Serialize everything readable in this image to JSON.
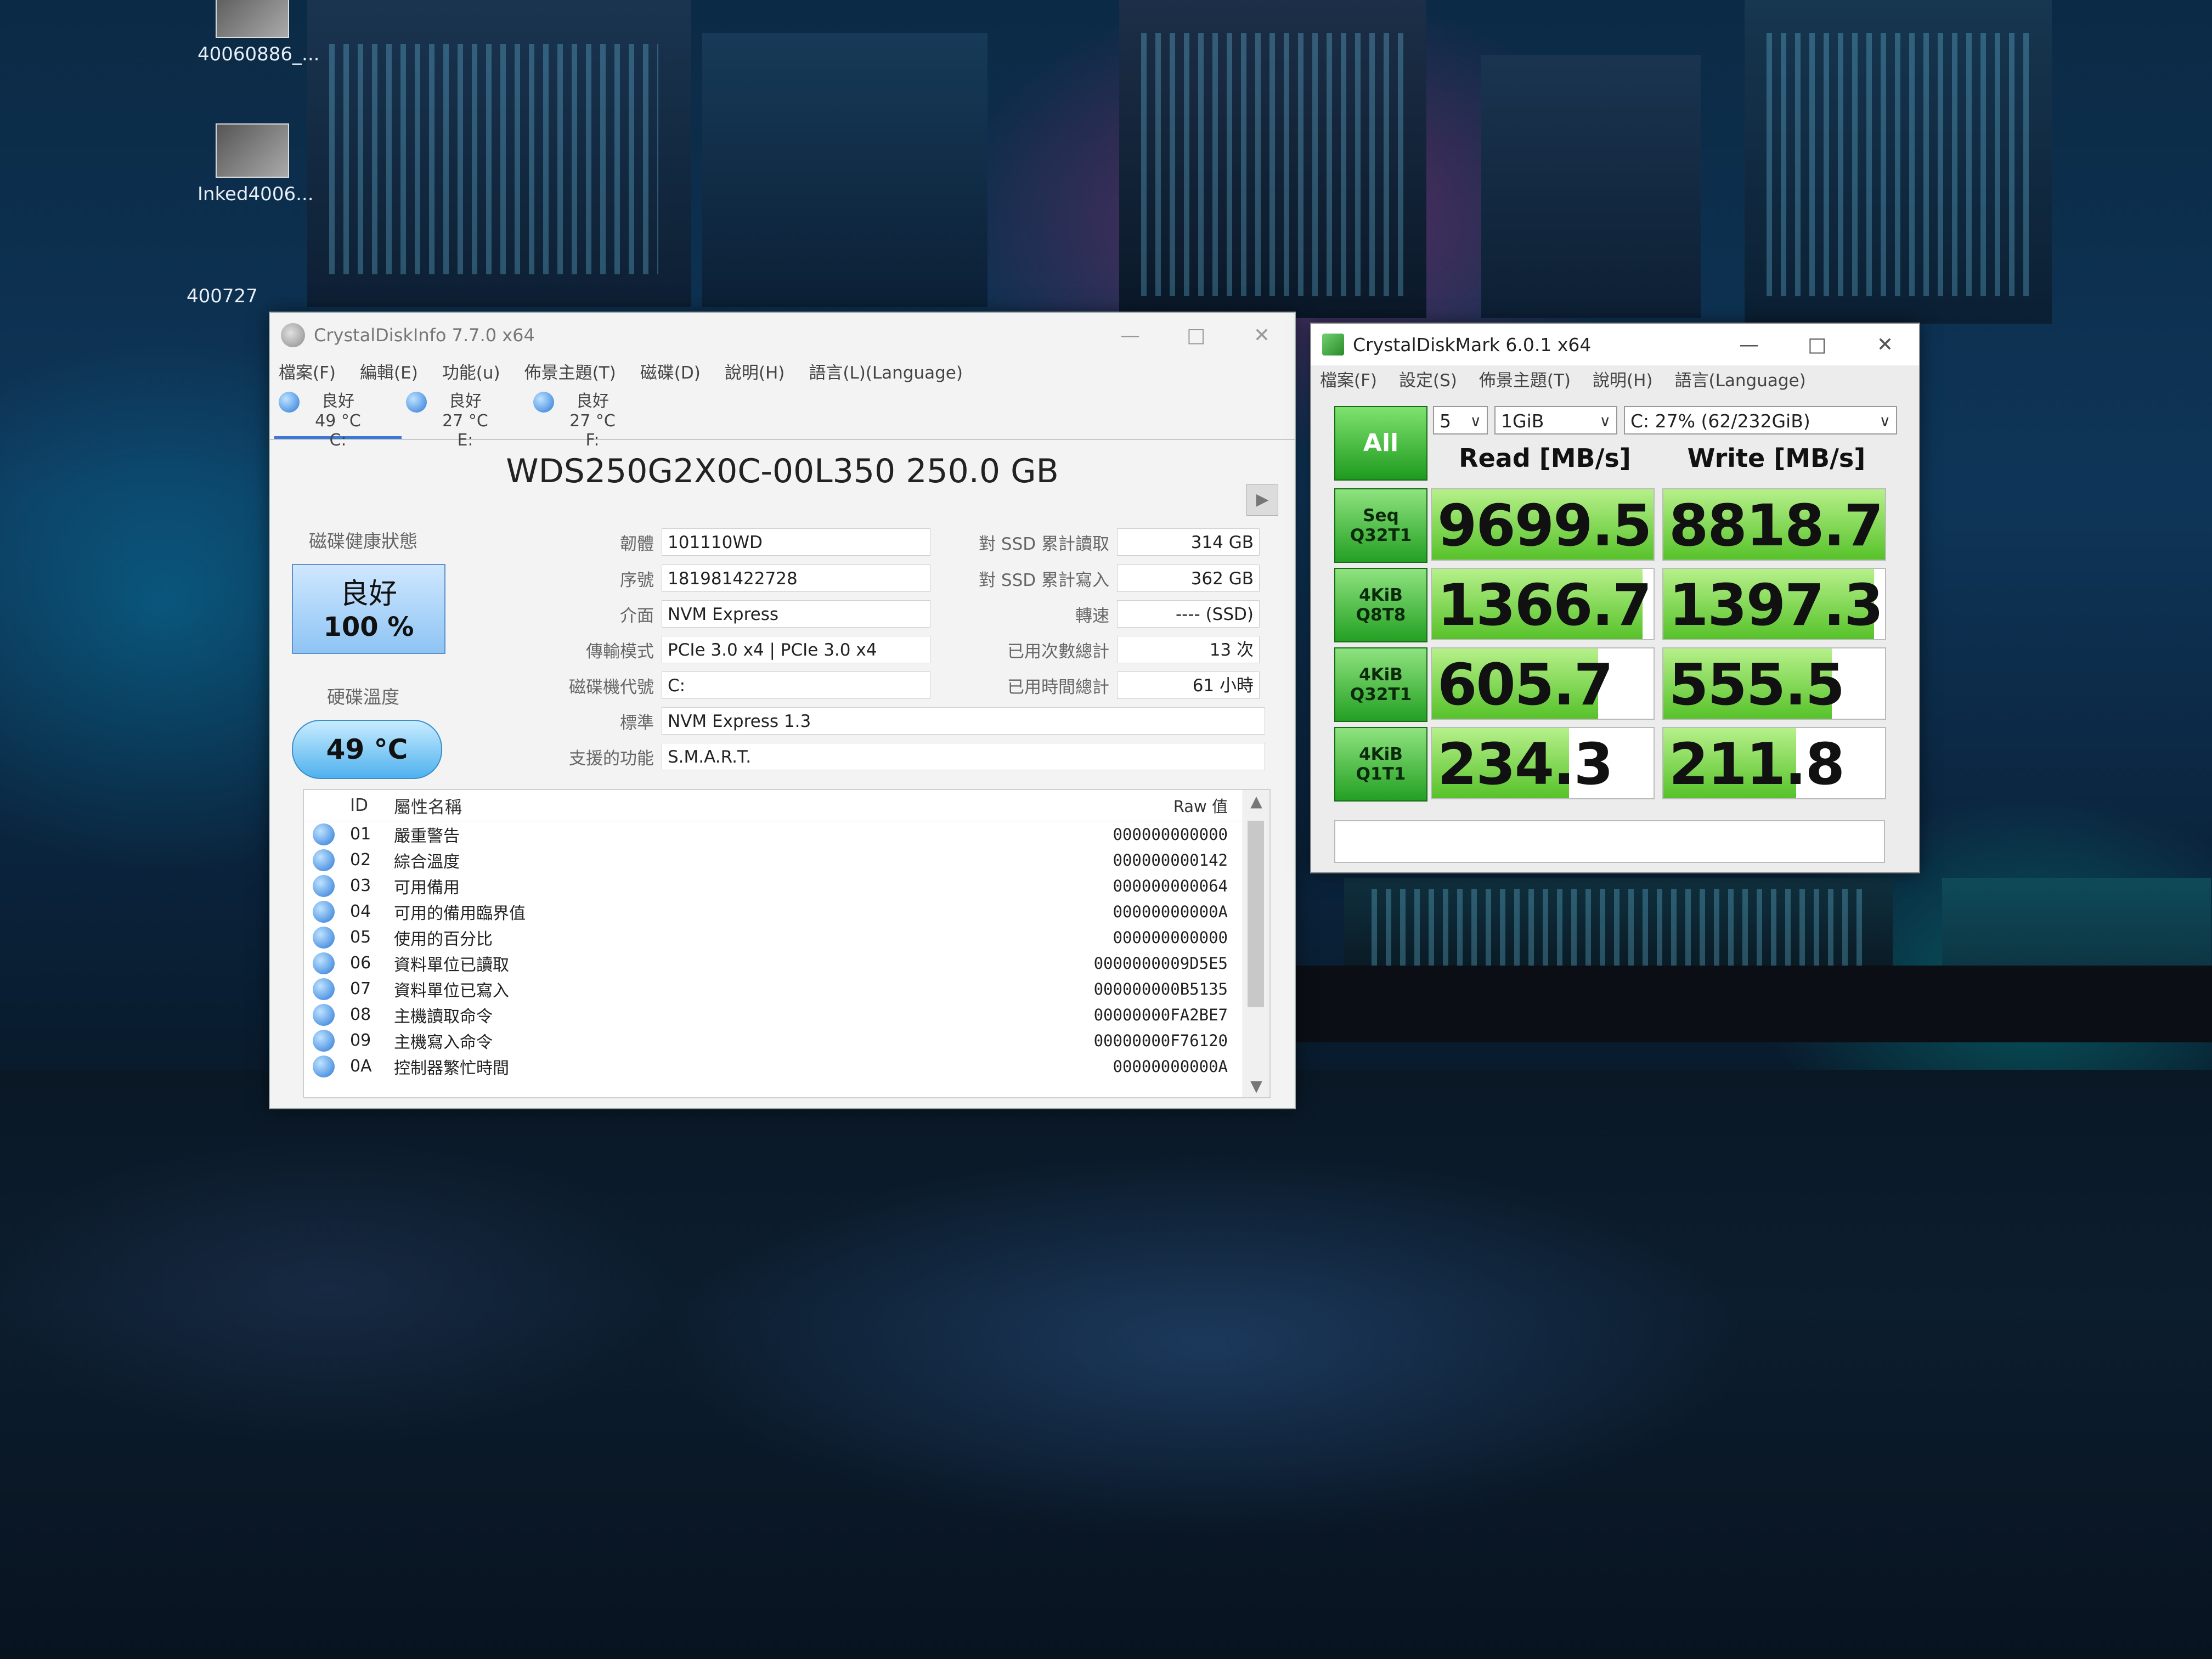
{
  "desktop": {
    "icons": [
      {
        "label": "40060886_..."
      },
      {
        "label": "Inked4006..."
      },
      {
        "label": "400727"
      }
    ]
  },
  "cdi": {
    "title": "CrystalDiskInfo 7.7.0 x64",
    "menu": [
      "檔案(F)",
      "編輯(E)",
      "功能(u)",
      "佈景主題(T)",
      "磁碟(D)",
      "說明(H)",
      "語言(L)(Language)"
    ],
    "disks": [
      {
        "status": "良好",
        "temp": "49 °C",
        "letter": "C:"
      },
      {
        "status": "良好",
        "temp": "27 °C",
        "letter": "E:"
      },
      {
        "status": "良好",
        "temp": "27 °C",
        "letter": "F:"
      }
    ],
    "model": "WDS250G2X0C-00L350 250.0 GB",
    "health_label": "磁碟健康狀態",
    "health_status": "良好",
    "health_percent": "100 %",
    "temp_label": "硬碟溫度",
    "temp_value": "49 °C",
    "fields": {
      "firmware_label": "韌體",
      "firmware": "101110WD",
      "serial_label": "序號",
      "serial": "181981422728",
      "interface_label": "介面",
      "interface": "NVM Express",
      "transfer_label": "傳輸模式",
      "transfer": "PCIe 3.0 x4 | PCIe 3.0 x4",
      "drive_letter_label": "磁碟機代號",
      "drive_letter": "C:",
      "standard_label": "標準",
      "standard": "NVM Express 1.3",
      "features_label": "支援的功能",
      "features": "S.M.A.R.T.",
      "host_reads_label": "對 SSD 累計讀取",
      "host_reads": "314 GB",
      "host_writes_label": "對 SSD 累計寫入",
      "host_writes": "362 GB",
      "rotation_label": "轉速",
      "rotation": "---- (SSD)",
      "power_count_label": "已用次數總計",
      "power_count": "13 次",
      "power_hours_label": "已用時間總計",
      "power_hours": "61 小時"
    },
    "table": {
      "col_id": "ID",
      "col_name": "屬性名稱",
      "col_raw": "Raw 值",
      "rows": [
        {
          "id": "01",
          "name": "嚴重警告",
          "raw": "000000000000"
        },
        {
          "id": "02",
          "name": "綜合溫度",
          "raw": "000000000142"
        },
        {
          "id": "03",
          "name": "可用備用",
          "raw": "000000000064"
        },
        {
          "id": "04",
          "name": "可用的備用臨界值",
          "raw": "00000000000A"
        },
        {
          "id": "05",
          "name": "使用的百分比",
          "raw": "000000000000"
        },
        {
          "id": "06",
          "name": "資料單位已讀取",
          "raw": "0000000009D5E5"
        },
        {
          "id": "07",
          "name": "資料單位已寫入",
          "raw": "000000000B5135"
        },
        {
          "id": "08",
          "name": "主機讀取命令",
          "raw": "00000000FA2BE7"
        },
        {
          "id": "09",
          "name": "主機寫入命令",
          "raw": "00000000F76120"
        },
        {
          "id": "0A",
          "name": "控制器繁忙時間",
          "raw": "00000000000A"
        }
      ]
    }
  },
  "cdm": {
    "title": "CrystalDiskMark 6.0.1 x64",
    "menu": [
      "檔案(F)",
      "設定(S)",
      "佈景主題(T)",
      "說明(H)",
      "語言(Language)"
    ],
    "all_label": "All",
    "count": "5",
    "size": "1GiB",
    "drive": "C: 27% (62/232GiB)",
    "read_header": "Read [MB/s]",
    "write_header": "Write [MB/s]",
    "rows": [
      {
        "label1": "Seq",
        "label2": "Q32T1",
        "read": "9699.5",
        "write": "8818.7",
        "read_fill": 1.0,
        "write_fill": 1.0
      },
      {
        "label1": "4KiB",
        "label2": "Q8T8",
        "read": "1366.7",
        "write": "1397.3",
        "read_fill": 0.95,
        "write_fill": 0.95
      },
      {
        "label1": "4KiB",
        "label2": "Q32T1",
        "read": "605.7",
        "write": "555.5",
        "read_fill": 0.75,
        "write_fill": 0.76
      },
      {
        "label1": "4KiB",
        "label2": "Q1T1",
        "read": "234.3",
        "write": "211.8",
        "read_fill": 0.62,
        "write_fill": 0.6
      }
    ]
  }
}
